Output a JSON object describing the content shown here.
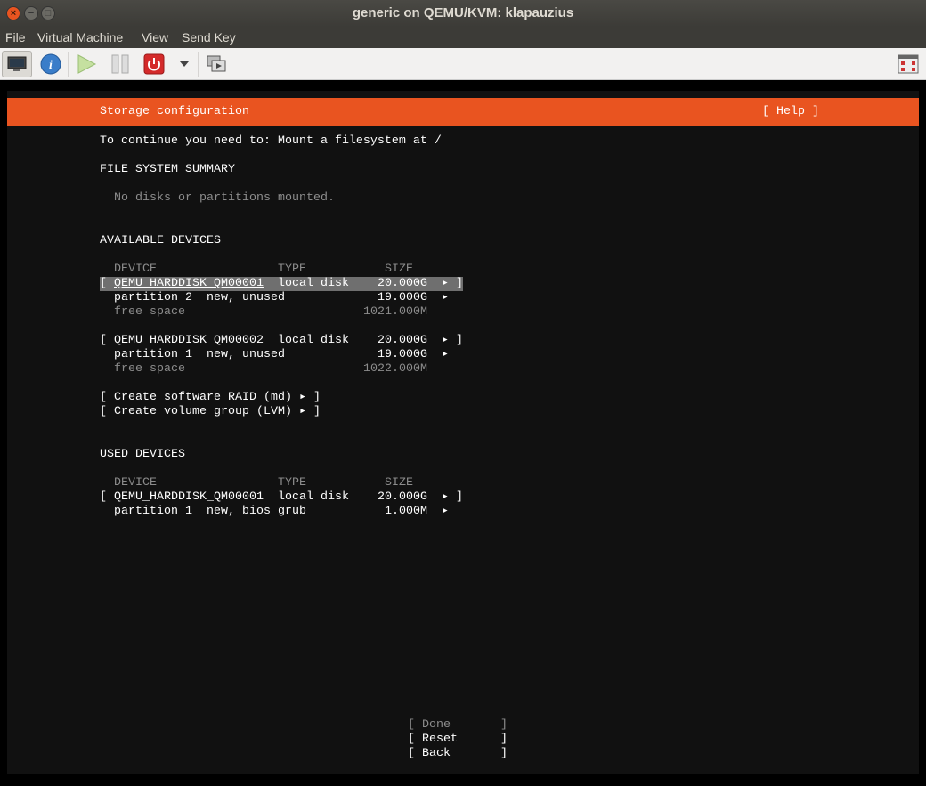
{
  "window": {
    "title": "generic on QEMU/KVM: klapauzius",
    "close": "×",
    "minimize": "−",
    "maximize": "□"
  },
  "menu": [
    "File",
    "Virtual Machine",
    "View",
    "Send Key"
  ],
  "toolbar": {
    "icons": [
      "monitor-icon",
      "info-icon",
      "play-icon",
      "pause-icon",
      "power-icon",
      "dropdown-icon",
      "snapshot-icon",
      "fullscreen-icon"
    ]
  },
  "colors": {
    "accent": "#e95420",
    "selected": "#6f6f6f",
    "background": "#111111"
  },
  "installer": {
    "title": "Storage configuration",
    "help": "[ Help ]",
    "instruction": "To continue you need to: Mount a filesystem at /",
    "fs_summary_heading": "FILE SYSTEM SUMMARY",
    "fs_summary_empty": "No disks or partitions mounted.",
    "available_heading": "AVAILABLE DEVICES",
    "columns": {
      "device": "DEVICE",
      "type": "TYPE",
      "size": "SIZE"
    },
    "available": [
      {
        "device": "QEMU_HARDDISK_QM00001",
        "type": "local disk",
        "size": "20.000G",
        "selected": true,
        "children": [
          {
            "device": "partition 2",
            "type": "new, unused",
            "size": "19.000G"
          },
          {
            "device": "free space",
            "size": "1021.000M"
          }
        ]
      },
      {
        "device": "QEMU_HARDDISK_QM00002",
        "type": "local disk",
        "size": "20.000G",
        "children": [
          {
            "device": "partition 1",
            "type": "new, unused",
            "size": "19.000G"
          },
          {
            "device": "free space",
            "size": "1022.000M"
          }
        ]
      }
    ],
    "actions": [
      "[ Create software RAID (md) ▸ ]",
      "[ Create volume group (LVM) ▸ ]"
    ],
    "used_heading": "USED DEVICES",
    "used": [
      {
        "device": "QEMU_HARDDISK_QM00001",
        "type": "local disk",
        "size": "20.000G",
        "children": [
          {
            "device": "partition 1",
            "type": "new, bios_grub",
            "size": "1.000M"
          }
        ]
      }
    ],
    "arrow": "▸",
    "lb": "[",
    "rb": "]",
    "buttons": [
      {
        "label": "[ Done       ]",
        "enabled": false
      },
      {
        "label": "[ Reset      ]",
        "enabled": true
      },
      {
        "label": "[ Back       ]",
        "enabled": true
      }
    ]
  }
}
